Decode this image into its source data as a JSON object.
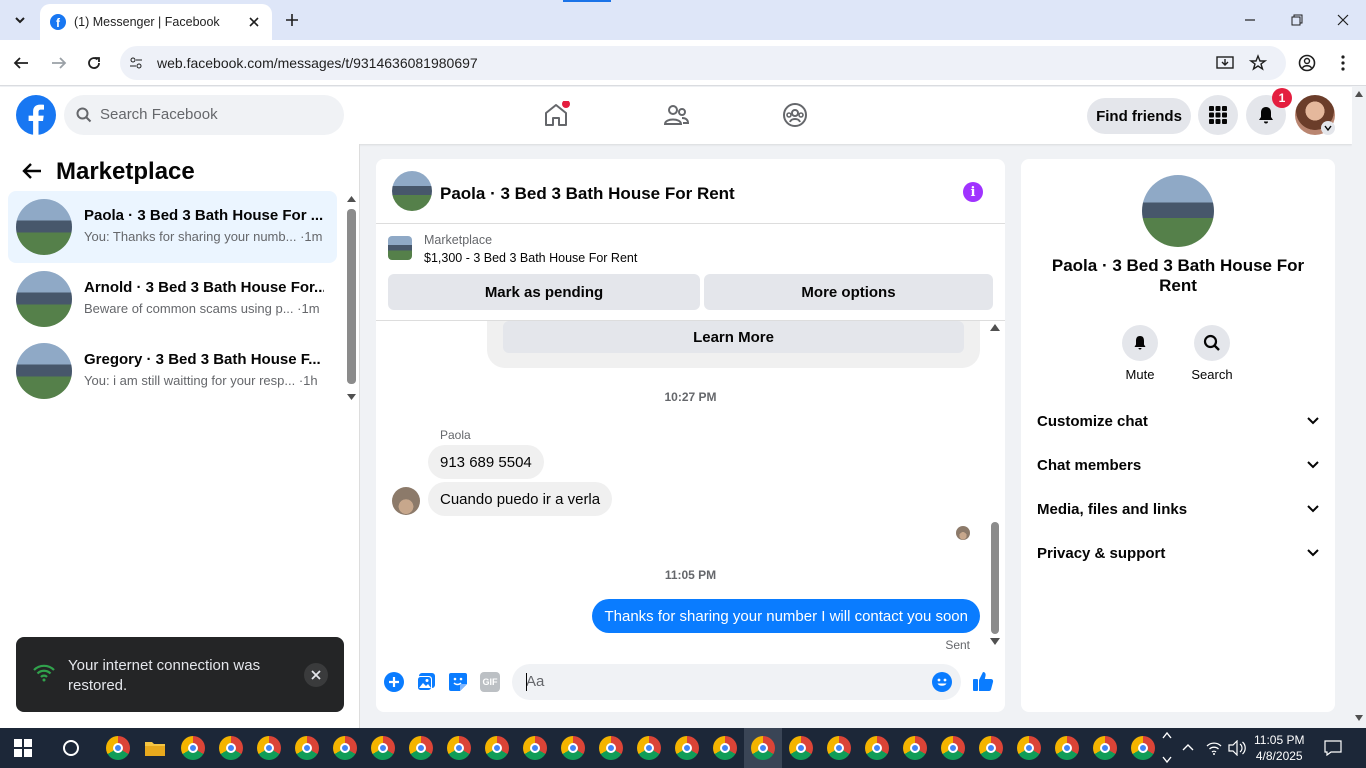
{
  "browser": {
    "tab_title": "(1) Messenger | Facebook",
    "url": "web.facebook.com/messages/t/9314636081980697"
  },
  "fb_header": {
    "search_placeholder": "Search Facebook",
    "find_friends": "Find friends",
    "notification_count": "1"
  },
  "left": {
    "title": "Marketplace",
    "conversations": [
      {
        "name": "Paola · 3 Bed 3 Bath House For ...",
        "snippet": "You: Thanks for sharing your numb... ·1m"
      },
      {
        "name": "Arnold · 3 Bed 3 Bath House For...",
        "snippet": "Beware of common scams using p... ·1m"
      },
      {
        "name": "Gregory · 3 Bed 3 Bath House F...",
        "snippet": "You: i am still waitting for your resp... ·1h"
      }
    ]
  },
  "chat": {
    "title": "Paola · 3 Bed 3 Bath House For Rent",
    "marketplace_label": "Marketplace",
    "listing": "$1,300 - 3 Bed 3 Bath House For Rent",
    "mark_pending": "Mark as pending",
    "more_options": "More options",
    "learn_more": "Learn More",
    "time1": "10:27 PM",
    "sender": "Paola",
    "msg1": "913 689 5504",
    "msg2": "Cuando puedo ir a verla",
    "time2": "11:05 PM",
    "my_msg": "Thanks for sharing your number I will contact you soon",
    "sent": "Sent",
    "input_placeholder": "Aa",
    "gif_label": "GIF"
  },
  "right": {
    "name": "Paola · 3 Bed 3 Bath House For Rent",
    "mute": "Mute",
    "search": "Search",
    "sections": [
      "Customize chat",
      "Chat members",
      "Media, files and links",
      "Privacy & support"
    ]
  },
  "toast": {
    "message": "Your internet connection was restored."
  },
  "taskbar": {
    "time": "11:05 PM",
    "date": "4/8/2025"
  },
  "colors": {
    "fb_blue": "#1877f2",
    "messenger_blue": "#0a7cff",
    "info_purple": "#a033ff",
    "badge_red": "#e41e3f"
  }
}
